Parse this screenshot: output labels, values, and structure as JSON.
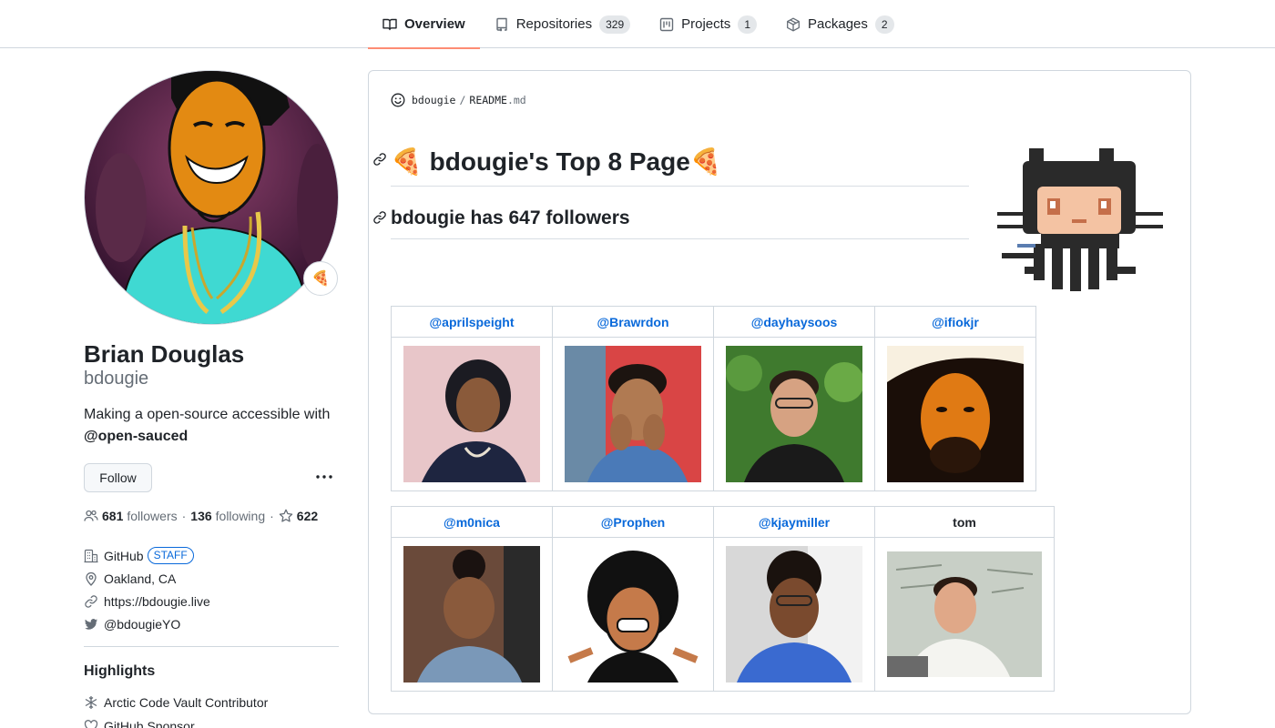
{
  "tabs": [
    {
      "label": "Overview",
      "count": null,
      "icon": "book-icon"
    },
    {
      "label": "Repositories",
      "count": "329",
      "icon": "repo-icon"
    },
    {
      "label": "Projects",
      "count": "1",
      "icon": "project-icon"
    },
    {
      "label": "Packages",
      "count": "2",
      "icon": "package-icon"
    }
  ],
  "profile": {
    "status_emoji": "🍕",
    "full_name": "Brian Douglas",
    "login": "bdougie",
    "bio_text": "Making a open-source accessible with",
    "bio_mention": "@open-sauced",
    "follow_label": "Follow",
    "followers_count": "681",
    "followers_label": "followers",
    "following_count": "136",
    "following_label": "following",
    "stars_count": "622",
    "company": "GitHub",
    "staff_badge": "STAFF",
    "location": "Oakland, CA",
    "website": "https://bdougie.live",
    "twitter": "@bdougieYO"
  },
  "highlights": {
    "title": "Highlights",
    "items": [
      "Arctic Code Vault Contributor",
      "GitHub Sponsor"
    ]
  },
  "readme": {
    "owner": "bdougie",
    "file_name": "README",
    "file_ext": ".md",
    "h1": "🍕 bdougie's Top 8 Page🍕",
    "h2": "bdougie has 647 followers",
    "top8_row1": [
      "@aprilspeight",
      "@Brawrdon",
      "@dayhaysoos",
      "@ifiokjr"
    ],
    "top8_row2": [
      "@m0nica",
      "@Prophen",
      "@kjaymiller",
      "tom"
    ]
  },
  "colors": {
    "accent": "#0969da",
    "tab_underline": "#fd8c73",
    "border": "#d0d7de",
    "muted": "#656d76"
  }
}
